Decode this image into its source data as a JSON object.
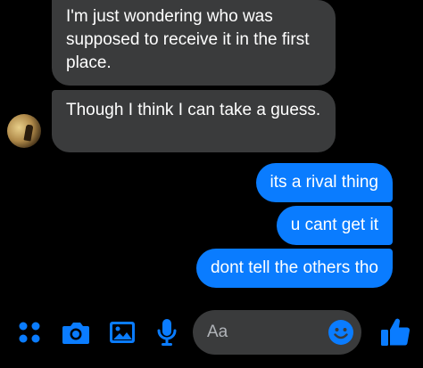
{
  "messages": {
    "incoming": [
      {
        "text": "I'm just wondering who was supposed to receive it in the first place."
      },
      {
        "text": "Though I think I can take a guess."
      }
    ],
    "outgoing": [
      {
        "text": "its a rival thing"
      },
      {
        "text": "u cant get it"
      },
      {
        "text": "dont tell the others tho"
      }
    ]
  },
  "composer": {
    "placeholder": "Aa"
  },
  "toolbar": {
    "icons": [
      "menu-dots-icon",
      "camera-icon",
      "image-icon",
      "microphone-icon",
      "emoji-icon",
      "thumbs-up-icon"
    ]
  },
  "colors": {
    "background": "#000000",
    "incoming_bubble": "#3a3b3c",
    "outgoing_bubble": "#0a7cff",
    "accent": "#0a7cff"
  }
}
